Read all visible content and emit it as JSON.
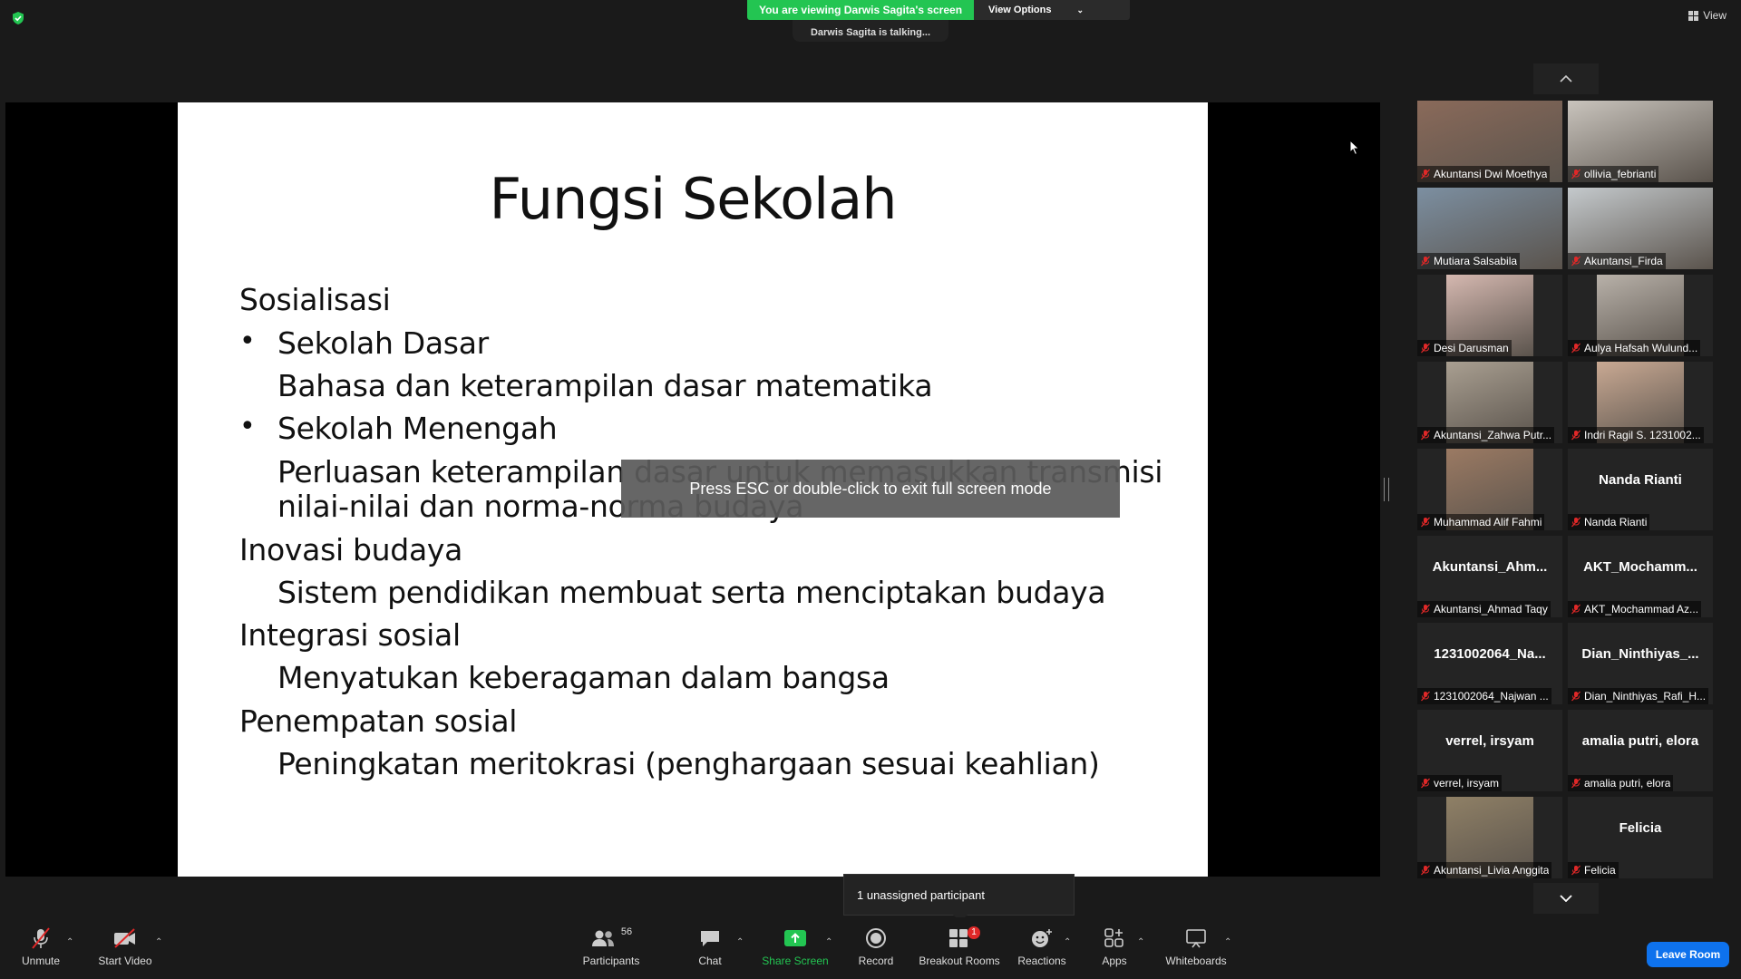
{
  "top": {
    "viewing_text": "You are viewing Darwis Sagita's screen",
    "view_options": "View Options",
    "talking": "Darwis Sagita is talking...",
    "view": "View"
  },
  "slide": {
    "title": "Fungsi Sekolah",
    "lines": [
      "Sosialisasi",
      "Sekolah Dasar",
      "Bahasa dan keterampilan dasar matematika",
      "Sekolah Menengah",
      "Perluasan keterampilan dasar untuk memasukkan transmisi",
      "nilai-nilai dan norma-norma budaya",
      "Inovasi budaya",
      "Sistem pendidikan membuat serta menciptakan budaya",
      "Integrasi sosial",
      "Menyatukan keberagaman dalam bangsa",
      "Penempatan sosial",
      "Peningkatan meritokrasi (penghargaan sesuai keahlian)"
    ],
    "bullet": "•"
  },
  "esc_toast": "Press ESC or double-click to exit full screen mode",
  "gallery": [
    {
      "name": "Akuntansi Dwi Moethya",
      "big": ""
    },
    {
      "name": "ollivia_febrianti",
      "big": ""
    },
    {
      "name": "Mutiara Salsabila",
      "big": ""
    },
    {
      "name": "Akuntansi_Firda",
      "big": ""
    },
    {
      "name": "Desi Darusman",
      "big": ""
    },
    {
      "name": "Aulya Hafsah Wulund...",
      "big": ""
    },
    {
      "name": "Akuntansi_Zahwa Putr...",
      "big": ""
    },
    {
      "name": "Indri Ragil S. 1231002...",
      "big": ""
    },
    {
      "name": "Muhammad Alif Fahmi",
      "big": ""
    },
    {
      "name": "Nanda Rianti",
      "big": "Nanda Rianti"
    },
    {
      "name": "Akuntansi_Ahmad Taqy",
      "big": "Akuntansi_Ahm..."
    },
    {
      "name": "AKT_Mochammad Az...",
      "big": "AKT_Mochamm..."
    },
    {
      "name": "1231002064_Najwan ...",
      "big": "1231002064_Na..."
    },
    {
      "name": "Dian_Ninthiyas_Rafi_H...",
      "big": "Dian_Ninthiyas_..."
    },
    {
      "name": "verrel, irsyam",
      "big": "verrel, irsyam"
    },
    {
      "name": "amalia putri, elora",
      "big": "amalia putri, elora"
    },
    {
      "name": "Akuntansi_Livia Anggita",
      "big": ""
    },
    {
      "name": "Felicia",
      "big": "Felicia"
    }
  ],
  "unassigned": "1 unassigned participant",
  "toolbar": {
    "unmute": "Unmute",
    "start_video": "Start Video",
    "participants": "Participants",
    "participants_count": "56",
    "chat": "Chat",
    "share_screen": "Share Screen",
    "record": "Record",
    "breakout_rooms": "Breakout Rooms",
    "breakout_badge": "1",
    "reactions": "Reactions",
    "apps": "Apps",
    "whiteboards": "Whiteboards",
    "leave": "Leave Room"
  },
  "colors": {
    "share_green": "#23c552",
    "leave_blue": "#0e72ed",
    "mic_red": "#e02828",
    "badge_red": "#e02828"
  }
}
